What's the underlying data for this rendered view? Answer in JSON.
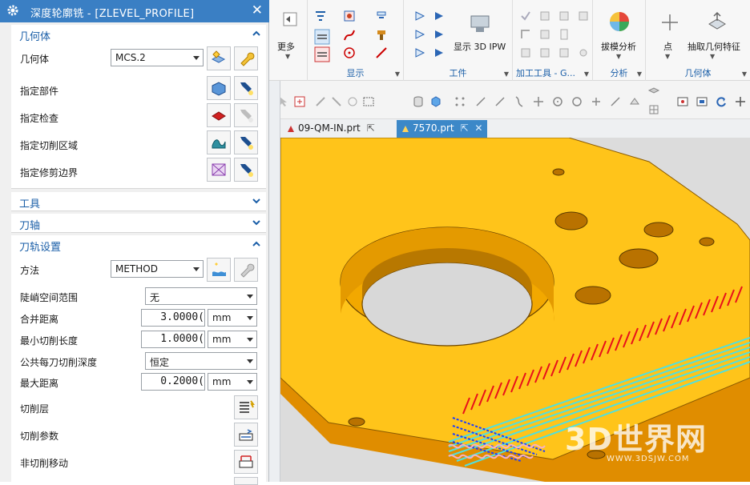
{
  "dialog": {
    "title": "深度轮廓铣 - [ZLEVEL_PROFILE]",
    "close_glyph": "✕",
    "geometry": {
      "title": "几何体",
      "geometry_label": "几何体",
      "geometry_value": "MCS.2",
      "specify_part": "指定部件",
      "specify_check": "指定检查",
      "specify_cut_area": "指定切削区域",
      "specify_trim_boundary": "指定修剪边界"
    },
    "tool": {
      "title": "工具"
    },
    "tool_axis": {
      "title": "刀轴"
    },
    "path_settings": {
      "title": "刀轨设置",
      "method_label": "方法",
      "method_value": "METHOD",
      "steep_label": "陡峭空间范围",
      "steep_value": "无",
      "merge_label": "合并距离",
      "merge_value": "3.0000(",
      "merge_unit": "mm",
      "min_cut_label": "最小切削长度",
      "min_cut_value": "1.0000(",
      "min_cut_unit": "mm",
      "depth_label": "公共每刀切削深度",
      "depth_value": "恒定",
      "max_dist_label": "最大距离",
      "max_dist_value": "0.2000(",
      "max_dist_unit": "mm",
      "cut_levels": "切削层",
      "cut_params": "切削参数",
      "non_cut_moves": "非切削移动"
    }
  },
  "ribbon": {
    "more": "更多",
    "display_group": "显示",
    "workpiece_group": "工件",
    "show_3d_ipw": "显示 3D IPW",
    "machining_tools_group": "加工工具 - G...",
    "draft_analysis": "拔模分析",
    "analysis_group": "分析",
    "point": "点",
    "extract_geometry": "抽取几何特征",
    "geometry_group": "几何体"
  },
  "tabs": [
    {
      "label": "09-QM-IN.prt",
      "active": false
    },
    {
      "label": "7570.prt",
      "active": true
    }
  ],
  "watermark": {
    "logo": "3D世界网",
    "url": "WWW.3DSJW.COM"
  },
  "colors": {
    "title_bar": "#3a7fc4",
    "section_title": "#1b5fa8",
    "part_top": "#ffc41a",
    "part_side": "#e08d00",
    "toolpath_red": "#e8101a",
    "toolpath_cyan": "#4fe0e0",
    "toolpath_blue": "#1a3cff"
  }
}
